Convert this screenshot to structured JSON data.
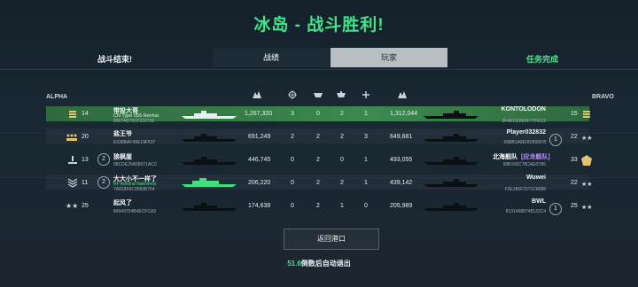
{
  "title": "冰岛 - 战斗胜利!",
  "tabs": {
    "left_label": "战斗结束!",
    "stats": "战绩",
    "players": "玩家",
    "right_label": "任务完成"
  },
  "teams": {
    "left": "ALPHA",
    "right": "BRAVO"
  },
  "header_icons": [
    "damage-icon",
    "target-icon",
    "kills-icon",
    "assist-icon",
    "survive-icon",
    "score-icon"
  ],
  "rows": [
    {
      "left": {
        "rank": "14",
        "name": "带投大哥",
        "tag": "CN Type 055 Renhai",
        "id": "8967A979CF233705",
        "damage": "1,267,320",
        "k1": "3",
        "k2": "0"
      },
      "right": {
        "k1": "2",
        "k2": "1",
        "damage": "1,312,044",
        "name": "KONTOLODON",
        "id": "3FAECE0E8F77FEC2",
        "rank": "15"
      },
      "selected": true
    },
    {
      "left": {
        "rank": "20",
        "name": "盐王爷",
        "tag": "",
        "id": "E638BAF49E19F537",
        "damage": "691,249",
        "k1": "2",
        "k2": "2"
      },
      "right": {
        "k1": "2",
        "k2": "3",
        "damage": "649,681",
        "name": "Player032832",
        "id": "55BB1A9E0D356978",
        "badge": "1",
        "rank": "22"
      }
    },
    {
      "left": {
        "rank": "13",
        "badge": "2",
        "name": "狼枫崖",
        "tag": "",
        "id": "58CDE29A58071AC0",
        "damage": "446,745",
        "k1": "0",
        "k2": "2"
      },
      "right": {
        "k1": "0",
        "k2": "1",
        "damage": "493,055",
        "name": "北海舰队",
        "clan": "[应龙舰队]",
        "id": "58B166C78CAE67A5",
        "rank": "33"
      }
    },
    {
      "left": {
        "rank": "11",
        "badge": "2",
        "name": "大大小不一样了",
        "tag": "RF Admiral Nakhimov",
        "id": "7A818F0C0083B754",
        "damage": "206,220",
        "k1": "0",
        "k2": "2"
      },
      "right": {
        "k1": "2",
        "k2": "1",
        "damage": "439,142",
        "name": "Wuwei",
        "id": "F3E185F2371C8588",
        "rank": "22"
      }
    },
    {
      "left": {
        "rank": "25",
        "name": "起风了",
        "tag": "",
        "id": "84943704B4ECFCA3",
        "damage": "174,638",
        "k1": "0",
        "k2": "2"
      },
      "right": {
        "k1": "1",
        "k2": "0",
        "damage": "205,989",
        "name": "BWL",
        "id": "81314688748132C4",
        "badge": "1",
        "rank": "25"
      }
    }
  ],
  "footer": {
    "return_button": "返回港口",
    "countdown_value": "51.6",
    "countdown_text": "倒数后自动退出"
  },
  "colors": {
    "accent": "#3ee68a",
    "selected_row": "#3b8a4e",
    "clan": "#b48cff"
  }
}
